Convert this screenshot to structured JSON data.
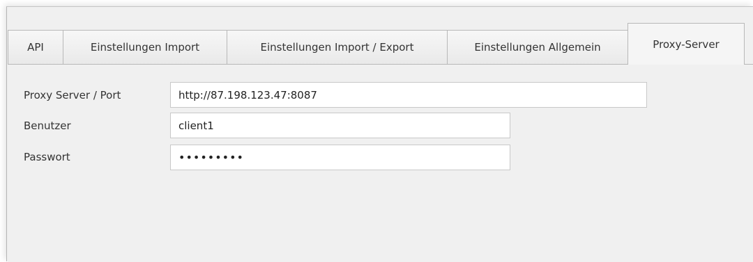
{
  "tabs": [
    {
      "label": "API",
      "active": false
    },
    {
      "label": "Einstellungen Import",
      "active": false
    },
    {
      "label": "Einstellungen Import / Export",
      "active": false
    },
    {
      "label": "Einstellungen Allgemein",
      "active": false
    },
    {
      "label": "Proxy-Server",
      "active": true
    }
  ],
  "form": {
    "proxy": {
      "label": "Proxy Server / Port",
      "value": "http://87.198.123.47:8087"
    },
    "user": {
      "label": "Benutzer",
      "value": "client1"
    },
    "password": {
      "label": "Passwort",
      "value": "•••••••••"
    }
  },
  "colors": {
    "panel_background": "#f0f0f0",
    "tab_border": "#b8b8b8",
    "field_border": "#c8c8c8"
  }
}
